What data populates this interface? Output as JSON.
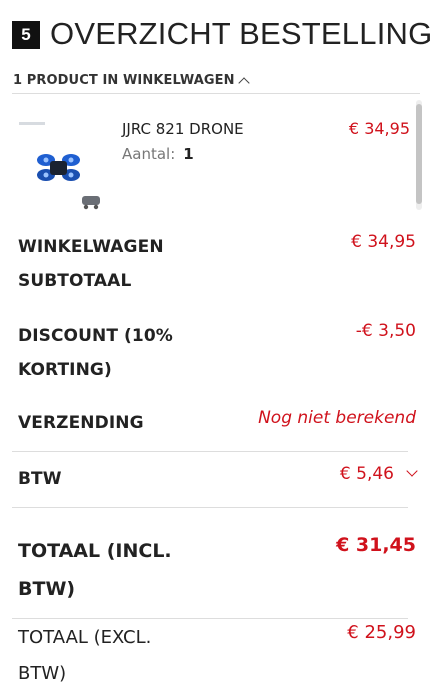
{
  "step": {
    "number": "5",
    "title": "OVERZICHT BESTELLING"
  },
  "cart_toggle": {
    "label": "1 PRODUCT IN WINKELWAGEN",
    "icon": "chevron-up-icon"
  },
  "products": [
    {
      "name": "JJRC 821 DRONE",
      "qty_label": "Aantal:",
      "qty": "1",
      "price": "€ 34,95",
      "image": "drone-product-image"
    }
  ],
  "summary": {
    "subtotal": {
      "label_line1": "WINKELWAGEN",
      "label_line2": "SUBTOTAAL",
      "value": "€ 34,95"
    },
    "discount": {
      "label_line1": "DISCOUNT (10%",
      "label_line2": "KORTING)",
      "value": "-€ 3,50"
    },
    "shipping": {
      "label": "VERZENDING",
      "value": "Nog niet berekend"
    },
    "tax": {
      "label": "BTW",
      "value": "€ 5,46",
      "icon": "chevron-down-icon"
    },
    "total_incl": {
      "label_line1": "TOTAAL (INCL.",
      "label_line2": "BTW)",
      "value": "€ 31,45"
    },
    "total_excl": {
      "label_line1": "TOTAAL (EXCL.",
      "label_line2": "BTW)",
      "value": "€ 25,99"
    }
  },
  "colors": {
    "price": "#d0121c",
    "text": "#222222",
    "divider": "#dddddd",
    "step_badge": "#111111"
  }
}
